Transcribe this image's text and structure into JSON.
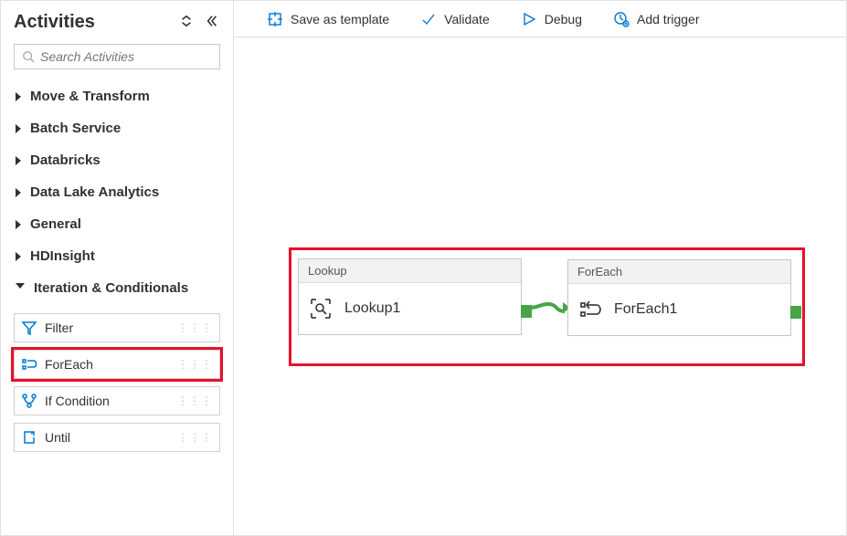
{
  "sidebar": {
    "title": "Activities",
    "search_placeholder": "Search Activities",
    "categories": [
      {
        "label": "Move & Transform",
        "open": false
      },
      {
        "label": "Batch Service",
        "open": false
      },
      {
        "label": "Databricks",
        "open": false
      },
      {
        "label": "Data Lake Analytics",
        "open": false
      },
      {
        "label": "General",
        "open": false
      },
      {
        "label": "HDInsight",
        "open": false
      },
      {
        "label": "Iteration & Conditionals",
        "open": true
      }
    ],
    "iteration_items": [
      {
        "id": "filter",
        "label": "Filter",
        "highlight": false
      },
      {
        "id": "foreach",
        "label": "ForEach",
        "highlight": true
      },
      {
        "id": "ifcond",
        "label": "If Condition",
        "highlight": false
      },
      {
        "id": "until",
        "label": "Until",
        "highlight": false
      }
    ]
  },
  "toolbar": {
    "save_template": "Save as template",
    "validate": "Validate",
    "debug": "Debug",
    "add_trigger": "Add trigger"
  },
  "canvas": {
    "node1": {
      "type": "Lookup",
      "name": "Lookup1"
    },
    "node2": {
      "type": "ForEach",
      "name": "ForEach1"
    }
  }
}
